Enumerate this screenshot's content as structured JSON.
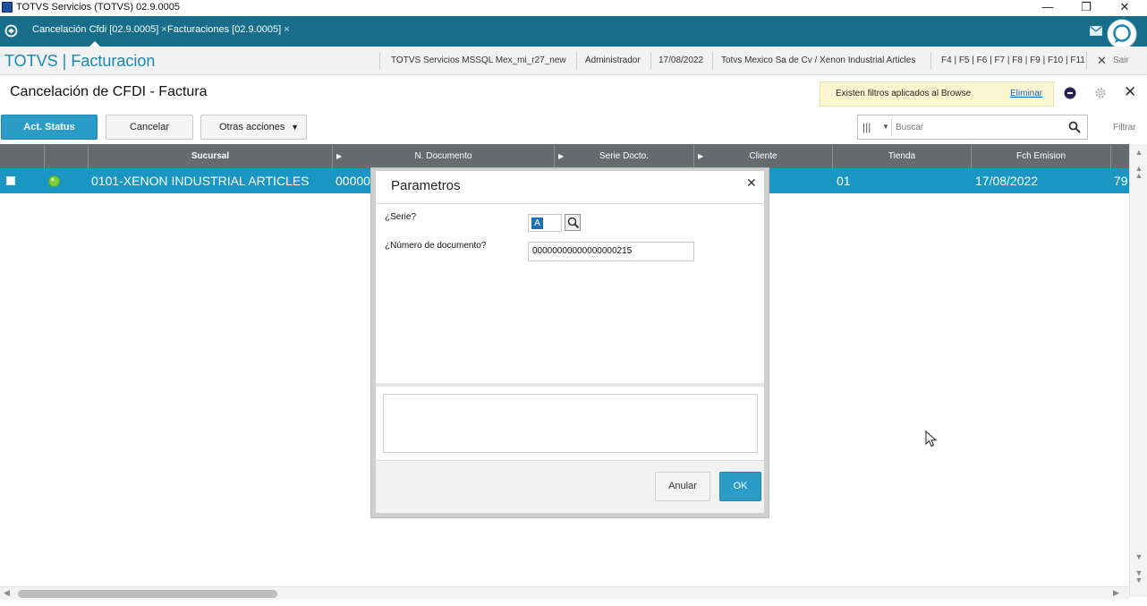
{
  "window": {
    "title": "TOTVS Servicios (TOTVS) 02.9.0005",
    "minimize": "—",
    "restore": "❐",
    "close": "✕"
  },
  "tabs": [
    {
      "label": "Cancelación Cfdi [02.9.0005]",
      "close": "×",
      "active": true
    },
    {
      "label": "Facturaciones [02.9.0005]",
      "close": "×",
      "active": false
    }
  ],
  "header": {
    "brand": "TOTVS | Facturacion",
    "environment": "TOTVS Servicios MSSQL Mex_mi_r27_new",
    "user": "Administrador",
    "date": "17/08/2022",
    "company": "Totvs Mexico Sa de Cv / Xenon Industrial Articles",
    "shortcuts": "F4 | F5 | F6 | F7 | F8 | F9 | F10 | F11",
    "exit_label": "Sair"
  },
  "page": {
    "title": "Cancelación de CFDI - Factura",
    "filter_banner": "Existen filtros aplicados al Browse",
    "filter_link": "Eliminar"
  },
  "toolbar": {
    "act_status": "Act. Status",
    "cancel": "Cancelar",
    "more": "Otras acciones",
    "search_placeholder": "Buscar",
    "filter": "Filtrar"
  },
  "grid": {
    "columns": [
      "Sucursal",
      "N. Documento",
      "Serie Docto.",
      "Cliente",
      "Tienda",
      "Fch Emision"
    ],
    "row": {
      "sucursal": "0101-XENON INDUSTRIAL ARTICLES",
      "documento": "00000",
      "tienda": "01",
      "fecha": "17/08/2022",
      "extra": "79"
    }
  },
  "dialog": {
    "title": "Parametros",
    "serie_label": "¿Serie?",
    "serie_value": "A",
    "numdoc_label": "¿Número de documento?",
    "numdoc_value": "00000000000000000215",
    "cancel": "Anular",
    "ok": "OK"
  },
  "colors": {
    "tabbar": "#186e8a",
    "accent": "#2a9cc7",
    "grid_header": "#666b6e",
    "grid_selected": "#1996c2",
    "status_ok": "#7ccf3a"
  }
}
